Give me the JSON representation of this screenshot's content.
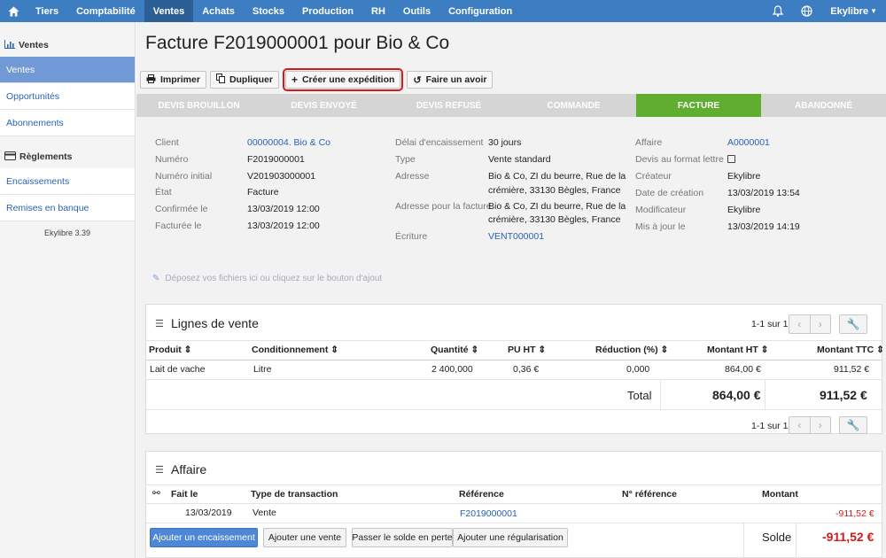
{
  "topbar": {
    "nav": [
      "Tiers",
      "Comptabilité",
      "Ventes",
      "Achats",
      "Stocks",
      "Production",
      "RH",
      "Outils",
      "Configuration"
    ],
    "active": "Ventes",
    "user": "Ekylibre",
    "icons": {
      "home": "home-icon",
      "bell": "bell-icon",
      "globe": "globe-icon",
      "caret": "caret-down-icon"
    }
  },
  "sidebar": {
    "sections": [
      {
        "title": "Ventes",
        "icon": "bar-chart-icon",
        "items": [
          "Ventes",
          "Opportunités",
          "Abonnements"
        ]
      },
      {
        "title": "Règlements",
        "icon": "card-icon",
        "items": [
          "Encaissements",
          "Remises en banque"
        ]
      }
    ],
    "active_item": "Ventes",
    "version": "Ekylibre 3.39"
  },
  "page": {
    "title": "Facture F2019000001 pour Bio & Co"
  },
  "toolbar": {
    "print": "Imprimer",
    "duplicate": "Dupliquer",
    "shipment": "Créer une expédition",
    "credit": "Faire un avoir"
  },
  "steps": [
    "Devis brouillon",
    "Devis envoyé",
    "Devis refusé",
    "Commande",
    "Facture",
    "Abandonné"
  ],
  "active_step": "Facture",
  "details": {
    "col1": {
      "labels": [
        "Client",
        "Numéro",
        "Numéro initial",
        "État",
        "Confirmée le",
        "Facturée le"
      ],
      "values": [
        "00000004. Bio & Co",
        "F2019000001",
        "V201903000001",
        "Facture",
        "13/03/2019 12:00",
        "13/03/2019 12:00"
      ]
    },
    "col2": {
      "labels": [
        "Délai d'encaissement",
        "Type",
        "Adresse",
        "Adresse pour la facture",
        "Écriture"
      ],
      "values": [
        "30 jours",
        "Vente standard",
        "Bio & Co, ZI du beurre, Rue de la crémière, 33130 Bègles, France",
        "Bio & Co, ZI du beurre, Rue de la crémière, 33130 Bègles, France",
        "VENT000001"
      ],
      "address_lines": [
        "Bio & Co, ZI du beurre, Rue de la",
        "crémière, 33130 Bègles, France"
      ]
    },
    "col3": {
      "labels": [
        "Affaire",
        "Devis au format lettre",
        "Créateur",
        "Date de création",
        "Modificateur",
        "Mis à jour le"
      ],
      "values": [
        "A0000001",
        "",
        "Ekylibre",
        "13/03/2019 13:54",
        "Ekylibre",
        "13/03/2019 14:19"
      ]
    }
  },
  "dropzone": "Déposez vos fichiers ici ou cliquez sur le bouton d'ajout",
  "lines": {
    "title": "Lignes de vente",
    "pager": "1-1 sur 1",
    "headers": [
      "Produit",
      "Conditionnement",
      "Quantité",
      "PU HT",
      "Réduction (%)",
      "Montant HT",
      "Montant TTC"
    ],
    "rows": [
      [
        "Lait de vache",
        "Litre",
        "2 400,000",
        "0,36 €",
        "0,000",
        "864,00 €",
        "911,52 €"
      ]
    ],
    "total_label": "Total",
    "total_ht": "864,00 €",
    "total_ttc": "911,52 €"
  },
  "affair": {
    "title": "Affaire",
    "headers": [
      "Fait le",
      "Type de transaction",
      "Référence",
      "N° référence",
      "Montant"
    ],
    "rows": [
      [
        "13/03/2019",
        "Vente",
        "F2019000001",
        "",
        "-911,52 €"
      ]
    ],
    "buttons": [
      "Ajouter un encaissement",
      "Ajouter une vente",
      "Passer le solde en perte",
      "Ajouter une régularisation"
    ],
    "balance_label": "Solde",
    "balance": "-911,52 €"
  },
  "colors": {
    "topbar": "#3d7ec3",
    "active_step": "#5fae2f",
    "link": "#2a62b6",
    "negative": "#d31a1a",
    "highlight": "#d31a1a"
  }
}
